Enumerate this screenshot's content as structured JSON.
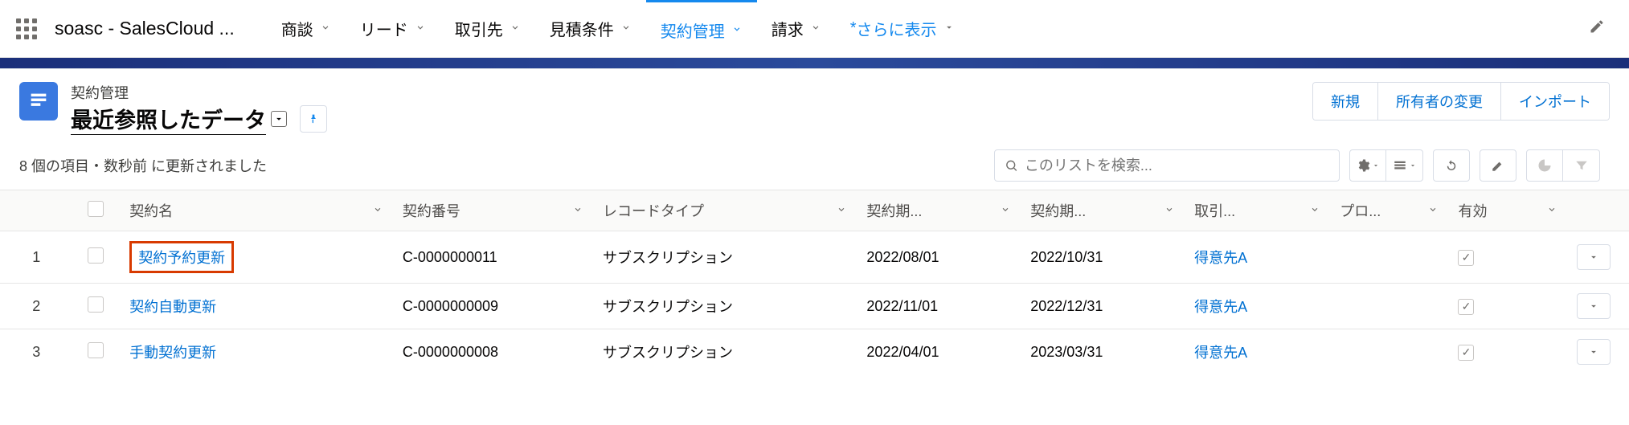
{
  "app": {
    "name": "soasc - SalesCloud ..."
  },
  "nav": {
    "items": [
      {
        "label": "商談"
      },
      {
        "label": "リード"
      },
      {
        "label": "取引先"
      },
      {
        "label": "見積条件"
      },
      {
        "label": "契約管理",
        "active": true
      },
      {
        "label": "請求"
      }
    ],
    "more_prefix": "*",
    "more_label": "さらに表示"
  },
  "header": {
    "object_label": "契約管理",
    "list_view": "最近参照したデータ",
    "meta": "8 個の項目・数秒前 に更新されました",
    "actions": {
      "new": "新規",
      "change_owner": "所有者の変更",
      "import": "インポート"
    },
    "search_placeholder": "このリストを検索..."
  },
  "columns": {
    "name": "契約名",
    "number": "契約番号",
    "record_type": "レコードタイプ",
    "start": "契約期...",
    "end": "契約期...",
    "account": "取引...",
    "pro": "プロ...",
    "active": "有効"
  },
  "rows": [
    {
      "idx": "1",
      "name": "契約予約更新",
      "highlight": true,
      "number": "C-0000000011",
      "record_type": "サブスクリプション",
      "start": "2022/08/01",
      "end": "2022/10/31",
      "account": "得意先A",
      "active": true
    },
    {
      "idx": "2",
      "name": "契約自動更新",
      "highlight": false,
      "number": "C-0000000009",
      "record_type": "サブスクリプション",
      "start": "2022/11/01",
      "end": "2022/12/31",
      "account": "得意先A",
      "active": true
    },
    {
      "idx": "3",
      "name": "手動契約更新",
      "highlight": false,
      "number": "C-0000000008",
      "record_type": "サブスクリプション",
      "start": "2022/04/01",
      "end": "2023/03/31",
      "account": "得意先A",
      "active": true
    }
  ]
}
